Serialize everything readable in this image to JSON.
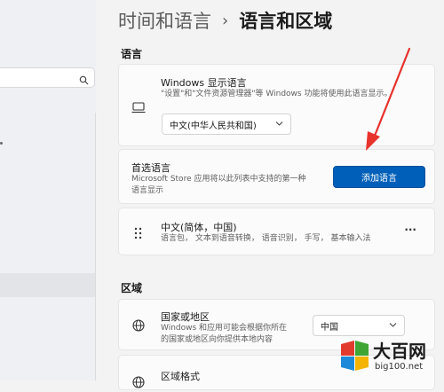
{
  "breadcrumb": {
    "parent": "时间和语言",
    "separator": "›",
    "current": "语言和区域"
  },
  "sections": {
    "language": "语言",
    "region": "区域"
  },
  "windows_display_language": {
    "title": "Windows 显示语言",
    "description": "\"设置\"和\"文件资源管理器\"等 Windows 功能将使用此语言显示。",
    "selected": "中文(中华人民共和国)",
    "icon": "monitor-icon"
  },
  "preferred_languages": {
    "title": "首选语言",
    "description_line1": "Microsoft Store 应用将以此列表中支持的第一种",
    "description_line2": "语言显示",
    "add_button": "添加语言"
  },
  "language_item": {
    "name": "中文(简体，中国)",
    "features": "语言包， 文本到语音转换， 语音识别， 手写， 基本输入法",
    "more": "···",
    "drag_icon": "drag-handle-icon"
  },
  "country_region": {
    "title": "国家或地区",
    "description_line1": "Windows 和应用可能会根据你所在",
    "description_line2": "的国家或地区向你提供本地内容",
    "selected": "中国",
    "icon": "globe-icon"
  },
  "regional_format": {
    "title": "区域格式"
  },
  "watermark": {
    "title": "大百网",
    "url": "big100.net"
  },
  "colors": {
    "accent": "#005fb8",
    "arrow": "#e8322c"
  }
}
